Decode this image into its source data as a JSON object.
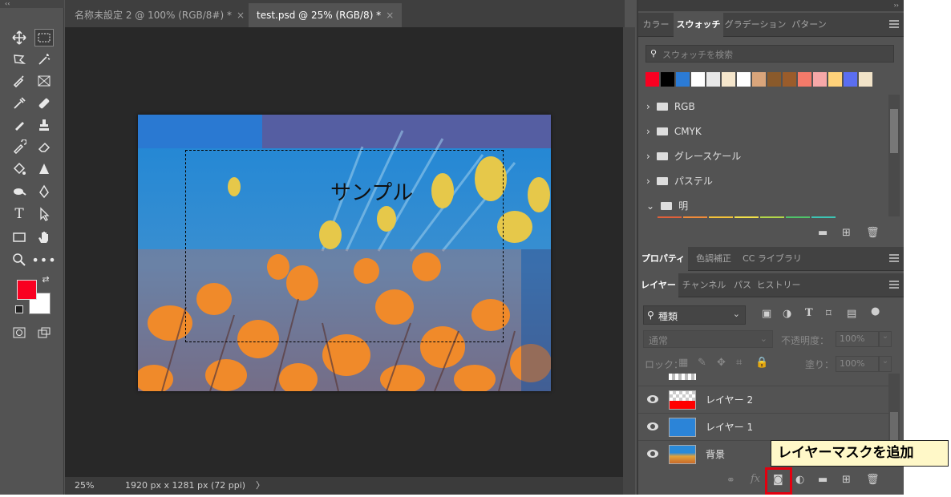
{
  "tabs": [
    {
      "title": "名称未設定 2 @ 100% (RGB/8#) *",
      "close": "×"
    },
    {
      "title": "test.psd @ 25% (RGB/8) *",
      "close": "×"
    }
  ],
  "toolbar": {
    "collapse_label": "‹‹",
    "foreground_color": "#f90021",
    "background_color": "#ffffff"
  },
  "canvas": {
    "sample_text": "サンプル"
  },
  "status": {
    "zoom": "25%",
    "doc_info": "1920 px x 1281 px (72 ppi)",
    "arrow": "〉"
  },
  "swatches_panel": {
    "collapse_label": "››",
    "tabs": [
      "カラー",
      "スウォッチ",
      "グラデーション",
      "パターン"
    ],
    "active_tab": "スウォッチ",
    "search_placeholder": "スウォッチを検索",
    "recent_colors": [
      "#f90021",
      "#000000",
      "#2b7bd6",
      "#ffffff",
      "#e8e8e8",
      "#f5e6cc",
      "#ffffff",
      "#d9a57b",
      "#8a5a2b",
      "#9a5c2b",
      "#f47a6a",
      "#f7a8a8",
      "#ffd27a",
      "#5b6ef0",
      "#f1e3c8"
    ],
    "groups": [
      "RGB",
      "CMYK",
      "グレースケール",
      "パステル",
      "明"
    ],
    "group_colors": [
      "#e0603a",
      "#f08a3a",
      "#f3c23a",
      "#f2e14a",
      "#b2d64a",
      "#4fc36a",
      "#3dc4b4"
    ]
  },
  "properties_panel": {
    "tabs": [
      "プロパティ",
      "色調補正",
      "CC ライブラリ"
    ]
  },
  "layers_panel": {
    "tabs": [
      "レイヤー",
      "チャンネル",
      "パス",
      "ヒストリー"
    ],
    "filter_label": "種類",
    "blend_mode": "通常",
    "opacity_label": "不透明度：",
    "opacity_value": "100%",
    "lock_label": "ロック：",
    "fill_label": "塗り：",
    "fill_value": "100%",
    "layers": [
      {
        "name": "レイヤー 2"
      },
      {
        "name": "レイヤー 1"
      },
      {
        "name": "背景"
      }
    ],
    "footer_fx": "fx"
  },
  "tooltip": {
    "text": "レイヤーマスクを追加"
  }
}
